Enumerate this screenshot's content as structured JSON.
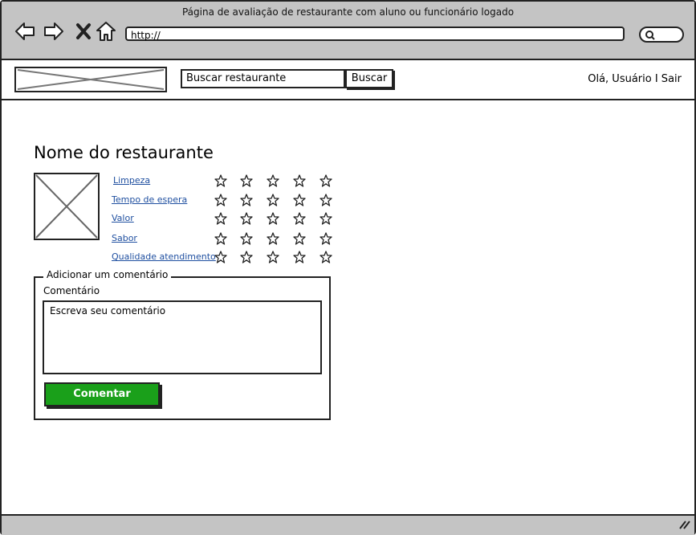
{
  "window": {
    "title": "Página de avaliação de restaurante com aluno ou funcionário logado"
  },
  "browser": {
    "url": "http://",
    "icons": [
      "back-arrow-icon",
      "forward-arrow-icon",
      "close-x-icon",
      "home-icon",
      "search-icon"
    ]
  },
  "header": {
    "search_value": "Buscar restaurante",
    "search_button": "Buscar",
    "greeting": "Olá, Usuário I Sair"
  },
  "restaurant": {
    "name": "Nome do restaurante",
    "criteria": [
      {
        "label": "Limpeza",
        "stars": 5
      },
      {
        "label": "Tempo de espera",
        "stars": 5
      },
      {
        "label": "Valor",
        "stars": 5
      },
      {
        "label": "Sabor",
        "stars": 5
      },
      {
        "label": "Qualidade atendimento",
        "stars": 5
      }
    ]
  },
  "comment": {
    "legend": "Adicionar um comentário",
    "field_label": "Comentário",
    "placeholder": "Escreva seu comentário",
    "submit_label": "Comentar"
  },
  "colors": {
    "chrome": "#c4c4c4",
    "link": "#1f4fa0",
    "submit": "#1aa01a"
  }
}
